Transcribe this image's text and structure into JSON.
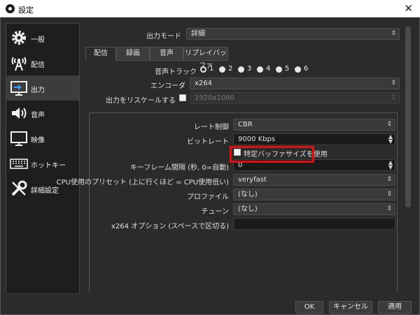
{
  "window": {
    "title": "設定",
    "close_glyph": "✕"
  },
  "sidebar": {
    "items": [
      {
        "label": "一般",
        "icon": "gear-icon"
      },
      {
        "label": "配信",
        "icon": "broadcast-icon"
      },
      {
        "label": "出力",
        "icon": "output-icon",
        "active": true
      },
      {
        "label": "音声",
        "icon": "speaker-icon"
      },
      {
        "label": "映像",
        "icon": "monitor-icon"
      },
      {
        "label": "ホットキー",
        "icon": "keyboard-icon"
      },
      {
        "label": "詳細設定",
        "icon": "wrench-icon"
      }
    ]
  },
  "output": {
    "mode_label": "出力モード",
    "mode_value": "詳細",
    "tabs": [
      "配信",
      "録画",
      "音声",
      "リプレイバッファ"
    ],
    "audio_track_label": "音声トラック",
    "tracks": [
      "1",
      "2",
      "3",
      "4",
      "5",
      "6"
    ],
    "encoder_label": "エンコーダ",
    "encoder_value": "x264",
    "rescale_label": "出力をリスケールする",
    "rescale_value": "1920x1080",
    "rate_control_label": "レート制御",
    "rate_control_value": "CBR",
    "bitrate_label": "ビットレート",
    "bitrate_value": "9000 Kbps",
    "custom_buffer_label": "特定バッファサイズを使用",
    "keyframe_label": "キーフレーム間隔 (秒, 0=自動)",
    "keyframe_value": "0",
    "preset_label": "CPU使用のプリセット (上に行くほど = CPU使用低い)",
    "preset_value": "veryfast",
    "profile_label": "プロファイル",
    "profile_value": "(なし)",
    "tune_label": "チューン",
    "tune_value": "(なし)",
    "x264_opts_label": "x264 オプション (スペースで区切る)",
    "x264_opts_value": ""
  },
  "buttons": {
    "ok": "OK",
    "cancel": "キャンセル",
    "apply": "適用"
  },
  "colors": {
    "highlight": "#e01010",
    "background": "#2b2b2b"
  }
}
